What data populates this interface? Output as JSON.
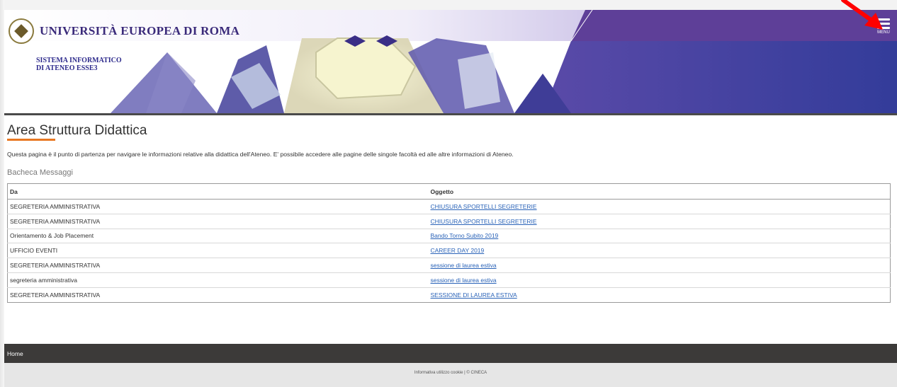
{
  "header": {
    "university_name": "UNIVERSITÀ EUROPEA DI ROMA",
    "system_name": "SISTEMA INFORMATICO\nDI ATENEO ESSE3",
    "menu_label": "MENU"
  },
  "page": {
    "title": "Area Struttura Didattica",
    "intro": "Questa pagina è il punto di partenza per navigare le informazioni relative alla didattica dell'Ateneo. E' possibile accedere alle pagine delle singole facoltà ed alle altre informazioni di Ateneo."
  },
  "board": {
    "title": "Bacheca Messaggi",
    "columns": [
      "Da",
      "Oggetto"
    ],
    "rows": [
      {
        "from": "SEGRETERIA AMMINISTRATIVA",
        "subject": "CHIUSURA SPORTELLI SEGRETERIE"
      },
      {
        "from": "SEGRETERIA AMMINISTRATIVA",
        "subject": "CHIUSURA SPORTELLI SEGRETERIE"
      },
      {
        "from": "Orientamento & Job Placement",
        "subject": "Bando Torno Subito 2019"
      },
      {
        "from": "UFFICIO EVENTI",
        "subject": "CAREER DAY 2019"
      },
      {
        "from": "SEGRETERIA AMMINISTRATIVA",
        "subject": "sessione di laurea estiva"
      },
      {
        "from": "segreteria amministrativa",
        "subject": "sessione di laurea estiva"
      },
      {
        "from": "SEGRETERIA AMMINISTRATIVA",
        "subject": "SESSIONE DI LAUREA ESTIVA"
      }
    ]
  },
  "footer": {
    "home_label": "Home",
    "legal": "Informativa utilizzo cookie | © CINECA"
  },
  "colors": {
    "header_purple": "#3d2f8f",
    "accent_orange": "#e87722",
    "link_blue": "#2a63b8",
    "footer_dark": "#3c3a39",
    "annotation_arrow": "#ff0000"
  }
}
